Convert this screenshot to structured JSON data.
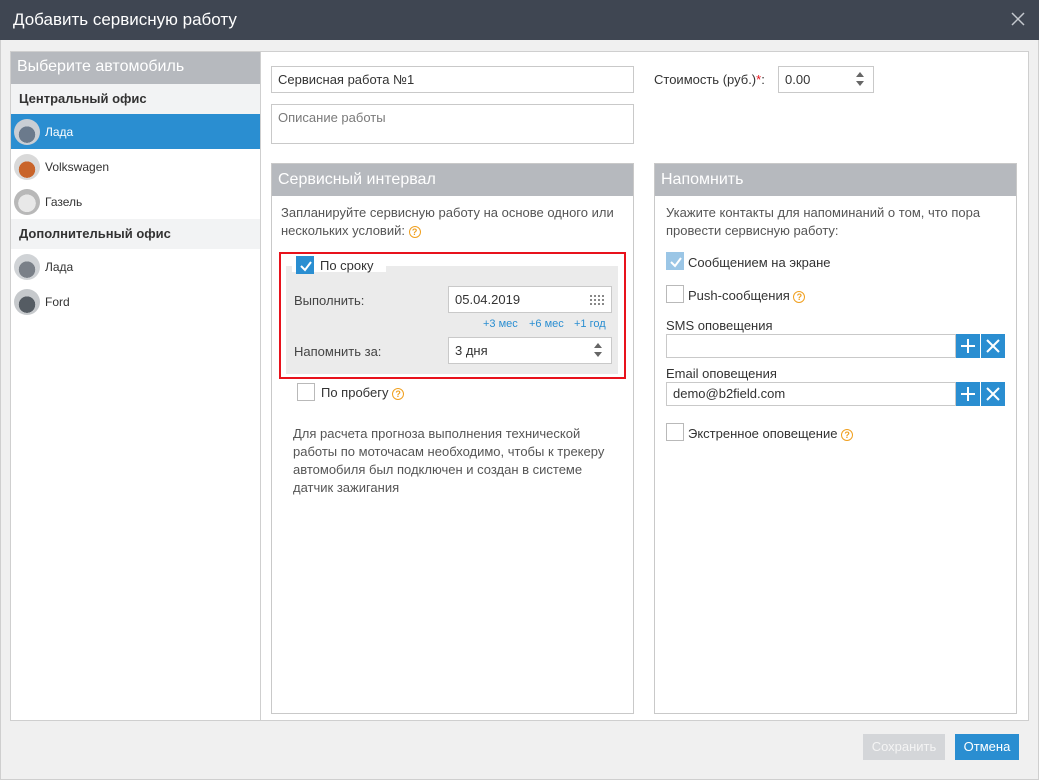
{
  "window": {
    "title": "Добавить сервисную работу"
  },
  "car_panel": {
    "header": "Выберите автомобиль",
    "groups": [
      {
        "name": "Центральный офис",
        "cars": [
          {
            "label": "Лада",
            "selected": true
          },
          {
            "label": "Volkswagen"
          },
          {
            "label": "Газель"
          }
        ]
      },
      {
        "name": "Дополнительный офис",
        "cars": [
          {
            "label": "Лада"
          },
          {
            "label": "Ford"
          }
        ]
      }
    ]
  },
  "work": {
    "name_value": "Сервисная работа №1",
    "description_placeholder": "Описание работы",
    "cost_label": "Стоимость (руб.)",
    "cost_required_mark": "*",
    "cost_colon": ":",
    "cost_value": "0.00"
  },
  "interval": {
    "header": "Сервисный интервал",
    "intro": "Запланируйте сервисную работу на основе одного или нескольких условий:",
    "by_term": {
      "label": "По сроку",
      "checked": true,
      "execute_label": "Выполнить:",
      "execute_value": "05.04.2019",
      "quick_links": [
        "+3 мес",
        "+6 мес",
        "+1 год"
      ],
      "remind_label": "Напомнить за:",
      "remind_value": "3 дня"
    },
    "by_mileage": {
      "label": "По пробегу",
      "checked": false
    },
    "note": "Для расчета прогноза выполнения технической работы по моточасам необходимо, чтобы к трекеру автомобиля был подключен и создан в системе датчик зажигания"
  },
  "remind": {
    "header": "Напомнить",
    "intro": "Укажите контакты для напоминаний о том, что пора провести сервисную работу:",
    "screen_message": {
      "label": "Сообщением на экране",
      "checked": true
    },
    "push": {
      "label": "Push-сообщения",
      "checked": false
    },
    "sms_label": "SMS оповещения",
    "sms_value": "",
    "email_label": "Email оповещения",
    "email_value": "demo@b2field.com",
    "emergency": {
      "label": "Экстренное оповещение",
      "checked": false
    }
  },
  "footer": {
    "save_label": "Сохранить",
    "cancel_label": "Отмена"
  },
  "colors": {
    "accent": "#2a8ed1",
    "titlebar": "#3f4652",
    "section_header": "#b6b9be",
    "highlight_border": "#e8121c",
    "help_icon": "#f0a020"
  }
}
